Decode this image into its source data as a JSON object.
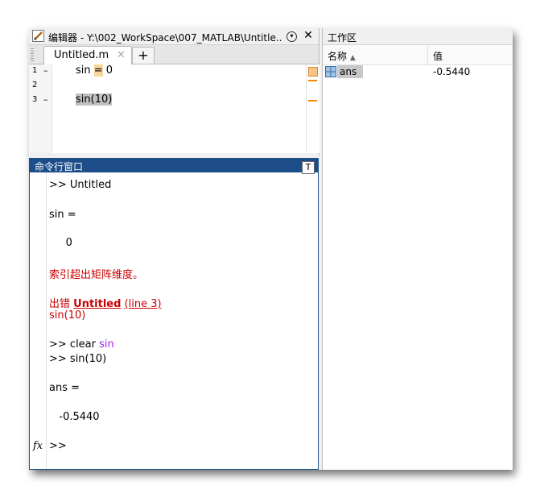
{
  "editor": {
    "title": "编辑器 - Y:\\002_WorkSpace\\007_MATLAB\\Untitle...",
    "tab_label": "Untitled.m",
    "tab_close": "✕",
    "add_tab": "+",
    "close_glyph": "✕",
    "menu_glyph": "▾",
    "lines": [
      {
        "num": "1",
        "marker": "–",
        "pre": "sin ",
        "mid": "=",
        "post": " 0"
      },
      {
        "num": "2",
        "marker": "",
        "text": ""
      },
      {
        "num": "3",
        "marker": "–",
        "text": "sin(10)"
      }
    ]
  },
  "command_window": {
    "title": "命令行窗口",
    "undock_glyph": "T",
    "lines": {
      "l1": ">> Untitled",
      "l2": "sin =",
      "l3": "     0",
      "l4": "索引超出矩阵维度。",
      "l5_prefix": "出错 ",
      "l5_link": "Untitled",
      "l5_space": " ",
      "l5_line": "(line 3)",
      "l6": "sin(10)",
      "l7_prefix": ">> clear ",
      "l7_var": "sin",
      "l8": ">> sin(10)",
      "l9": "ans =",
      "l10": "   -0.5440",
      "prompt": ">> "
    },
    "fx": "fx"
  },
  "workspace": {
    "title": "工作区",
    "col_name": "名称",
    "sort_glyph": "▲",
    "col_value": "值",
    "variables": [
      {
        "name": "ans",
        "value": "-0.5440"
      }
    ]
  }
}
